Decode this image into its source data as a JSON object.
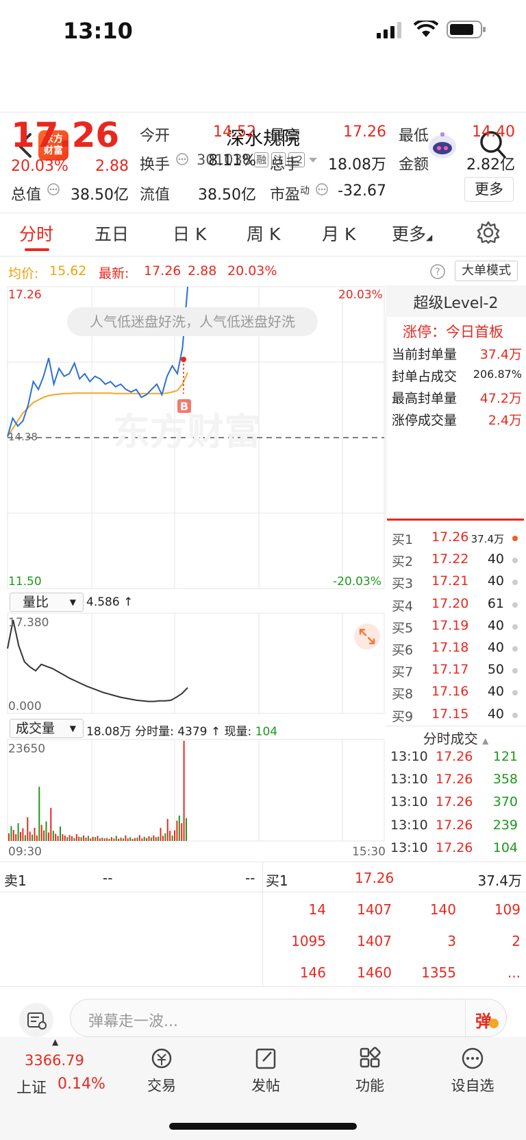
{
  "status_bar": {
    "time": "13:10"
  },
  "header": {
    "logo_text_1": "东方",
    "logo_text_2": "财富",
    "stock_name": "深水规院",
    "stock_code": "301038",
    "tags": [
      "融",
      "注",
      "L2"
    ]
  },
  "quote": {
    "price": "17.26",
    "change_pct": "20.03%",
    "change": "2.88",
    "open_label": "今开",
    "open": "14.52",
    "high_label": "最高",
    "high": "17.26",
    "low_label": "最低",
    "low": "14.40",
    "turnover_label": "换手",
    "turnover": "8.11%",
    "volume_label": "总手",
    "volume": "18.08万",
    "amount_label": "金额",
    "amount": "2.82亿",
    "mktcap_label": "总值",
    "mktcap": "38.50亿",
    "float_label": "流值",
    "float": "38.50亿",
    "pe_label": "市盈",
    "pe_sup": "动",
    "pe": "-32.67",
    "more": "更多"
  },
  "tabs": [
    "分时",
    "五日",
    "日 K",
    "周 K",
    "月 K",
    "更多"
  ],
  "info_line": {
    "avg_label": "均价:",
    "avg": "15.62",
    "latest_label": "最新:",
    "latest": "17.26",
    "latest_change": "2.88",
    "latest_pct": "20.03%",
    "big_order_mode": "大单模式"
  },
  "chart": {
    "top_price": "17.26",
    "top_pct": "20.03%",
    "base_price": "14.38",
    "bottom_price": "11.50",
    "bottom_pct": "-20.03%",
    "danmaku": "人气低迷盘好洗，人气低迷盘好洗",
    "buy_marker": "B",
    "watermark": "东方财富",
    "vr_label": "量比",
    "vr_value": "4.586 ↑",
    "vr_top": "17.380",
    "vr_bottom": "0.000",
    "vol_label": "成交量",
    "vol_info": "18.08万 分时量: 4379 ↑ 现量: ",
    "vol_now": "104",
    "vol_max": "23650",
    "time_start": "09:30",
    "time_end": "15:30"
  },
  "chart_data": [
    {
      "type": "line",
      "title": "",
      "x_range": [
        "09:30",
        "15:30"
      ],
      "ylim": [
        11.5,
        17.26
      ],
      "base": 14.38,
      "series": [
        {
          "name": "",
          "values": [
            14.4,
            14.75,
            14.6,
            14.7,
            15.0,
            15.45,
            15.3,
            15.55,
            15.9,
            15.4,
            15.7,
            15.55,
            15.6,
            15.8,
            15.5,
            15.6,
            15.45,
            15.55,
            15.5,
            15.4,
            15.45,
            15.35,
            15.4,
            15.3,
            15.25,
            15.3,
            15.15,
            15.2,
            15.3,
            15.4,
            15.2,
            15.55,
            15.75,
            15.6,
            16.1,
            17.26
          ]
        },
        {
          "name": "均价",
          "values": [
            14.4,
            14.55,
            14.7,
            14.85,
            14.95,
            15.05,
            15.1,
            15.15,
            15.18,
            15.2,
            15.21,
            15.22,
            15.22,
            15.23,
            15.23,
            15.23,
            15.23,
            15.23,
            15.23,
            15.23,
            15.23,
            15.22,
            15.22,
            15.22,
            15.22,
            15.22,
            15.22,
            15.22,
            15.22,
            15.22,
            15.22,
            15.23,
            15.25,
            15.28,
            15.4,
            15.62
          ]
        }
      ]
    },
    {
      "type": "line",
      "title": "量比",
      "ylim": [
        0.0,
        17.38
      ],
      "series": [
        {
          "name": "量比",
          "values": [
            12.0,
            17.38,
            12.5,
            9.5,
            8.5,
            7.8,
            9.0,
            8.6,
            8.2,
            7.6,
            7.0,
            6.4,
            5.9,
            5.4,
            4.9,
            4.5,
            4.1,
            3.7,
            3.4,
            3.1,
            2.8,
            2.6,
            2.4,
            2.2,
            2.1,
            2.0,
            2.0,
            2.1,
            2.1,
            2.2,
            2.8,
            3.5,
            4.586
          ]
        }
      ]
    },
    {
      "type": "bar",
      "title": "成交量",
      "ylim": [
        0,
        23650
      ],
      "values": [
        1800,
        3500,
        2600,
        1600,
        4200,
        2100,
        3000,
        1400,
        5600,
        2200,
        1500,
        3100,
        1300,
        12800,
        3800,
        2500,
        4600,
        2000,
        7800,
        2400,
        1700,
        1200,
        3400,
        1600,
        1300,
        900,
        1400,
        1100,
        700,
        1600,
        1000,
        900,
        1300,
        800,
        1200,
        600,
        1000,
        900,
        1200,
        600,
        800,
        600,
        700,
        500,
        900,
        600,
        1200,
        500,
        800,
        600,
        1300,
        600,
        900,
        500,
        700,
        800,
        1400,
        600,
        1000,
        700,
        1100,
        800,
        1300,
        900,
        1000,
        3100,
        1200,
        1800,
        5200,
        2400,
        1300,
        2500,
        4800,
        6000,
        4200,
        23650,
        5400
      ]
    }
  ],
  "level2": {
    "title": "超级Level-2",
    "limit_label": "涨停：",
    "limit_value": "今日首板",
    "rows": [
      {
        "label": "当前封单量",
        "value": "37.4万"
      },
      {
        "label": "封单占成交",
        "value": "206.87%"
      },
      {
        "label": "最高封单量",
        "value": "47.2万"
      },
      {
        "label": "涨停成交量",
        "value": "2.4万"
      }
    ]
  },
  "order_book": [
    {
      "label": "买1",
      "price": "17.26",
      "qty": "37.4万"
    },
    {
      "label": "买2",
      "price": "17.22",
      "qty": "40"
    },
    {
      "label": "买3",
      "price": "17.21",
      "qty": "40"
    },
    {
      "label": "买4",
      "price": "17.20",
      "qty": "61"
    },
    {
      "label": "买5",
      "price": "17.19",
      "qty": "40"
    },
    {
      "label": "买6",
      "price": "17.18",
      "qty": "40"
    },
    {
      "label": "买7",
      "price": "17.17",
      "qty": "50"
    },
    {
      "label": "买8",
      "price": "17.16",
      "qty": "40"
    },
    {
      "label": "买9",
      "price": "17.15",
      "qty": "40"
    }
  ],
  "ticks": {
    "title": "分时成交",
    "rows": [
      {
        "time": "13:10",
        "price": "17.26",
        "vol": "121"
      },
      {
        "time": "13:10",
        "price": "17.26",
        "vol": "358"
      },
      {
        "time": "13:10",
        "price": "17.26",
        "vol": "370"
      },
      {
        "time": "13:10",
        "price": "17.26",
        "vol": "239"
      },
      {
        "time": "13:10",
        "price": "17.26",
        "vol": "104"
      }
    ]
  },
  "queue": {
    "sell_label": "卖1",
    "sell_price": "--",
    "sell_qty": "--",
    "buy_label": "买1",
    "buy_price": "17.26",
    "buy_qty": "37.4万",
    "rows": [
      [
        "14",
        "1407",
        "140",
        "109"
      ],
      [
        "1095",
        "1407",
        "3",
        "2"
      ],
      [
        "146",
        "1460",
        "1355",
        "..."
      ]
    ]
  },
  "comment": {
    "placeholder": "弹幕走一波...",
    "send": "弹"
  },
  "bottom_bar": {
    "index_value": "3366.79",
    "index_name": "上证",
    "index_pct": "0.14%",
    "items": [
      "交易",
      "发帖",
      "功能",
      "设自选"
    ]
  },
  "colors": {
    "up": "#e8281e",
    "down": "#1a9a1a",
    "avg_line": "#f5a623",
    "price_line": "#2a6fd6"
  }
}
